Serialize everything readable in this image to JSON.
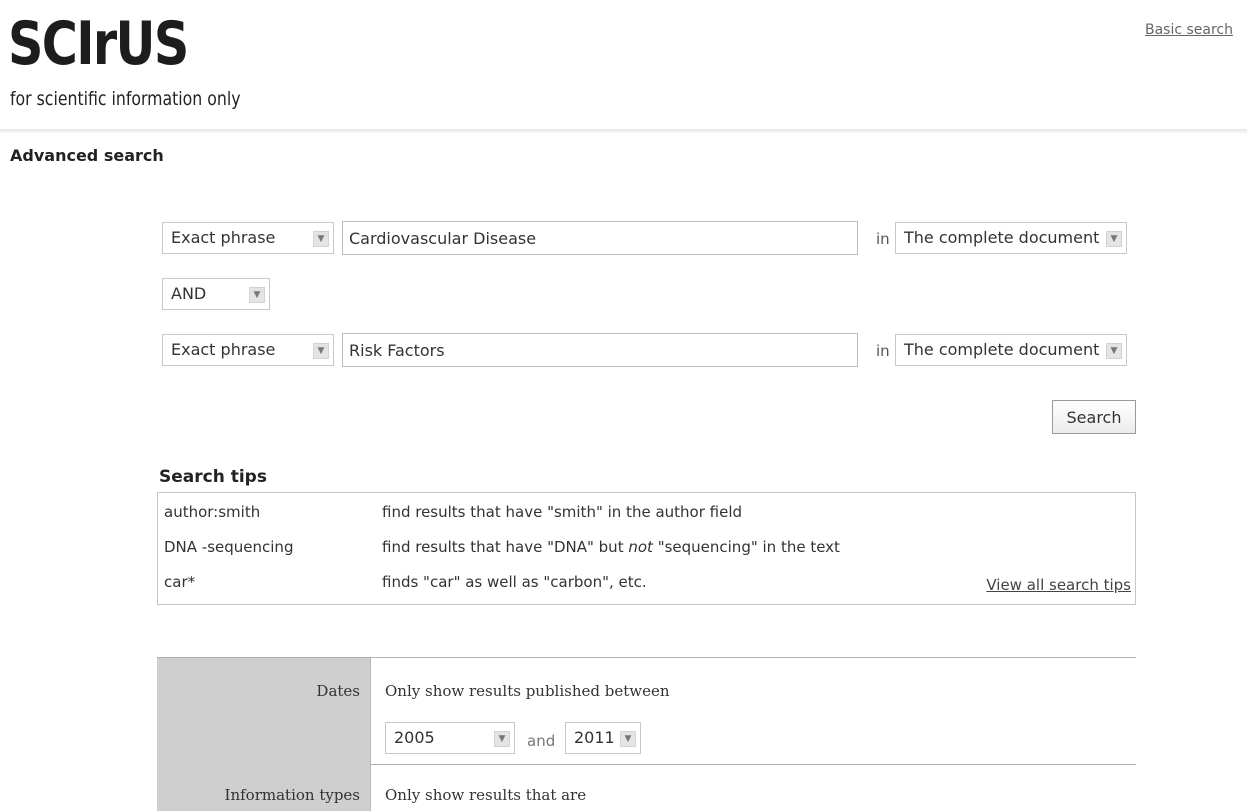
{
  "header": {
    "logo_text": "SCIrUS",
    "tagline": "for scientific information only",
    "basic_search_link": "Basic search"
  },
  "page_title": "Advanced search",
  "query": {
    "row1": {
      "match_type": "Exact phrase",
      "term": "Cardiovascular Disease",
      "in_label": "in",
      "field": "The complete document"
    },
    "boolean": "AND",
    "row2": {
      "match_type": "Exact phrase",
      "term": "Risk Factors",
      "in_label": "in",
      "field": "The complete document"
    },
    "search_button": "Search"
  },
  "tips": {
    "title": "Search tips",
    "rows": [
      {
        "key": "author:smith",
        "desc_pre": "find results that have \"smith\" in the author field",
        "desc_em": "",
        "desc_post": ""
      },
      {
        "key": "DNA -sequencing",
        "desc_pre": "find results that have \"DNA\" but ",
        "desc_em": "not",
        "desc_post": " \"sequencing\" in the text"
      },
      {
        "key": "car*",
        "desc_pre": "finds \"car\" as well as \"carbon\", etc.",
        "desc_em": "",
        "desc_post": ""
      }
    ],
    "view_all": "View all search tips"
  },
  "filters": {
    "dates": {
      "label": "Dates",
      "text": "Only show results published between",
      "from": "2005",
      "and_label": "and",
      "to": "2011"
    },
    "info_types": {
      "label": "Information types",
      "text": "Only show results that are"
    }
  },
  "icons": {
    "dropdown_arrow": "chevron-down-icon"
  }
}
